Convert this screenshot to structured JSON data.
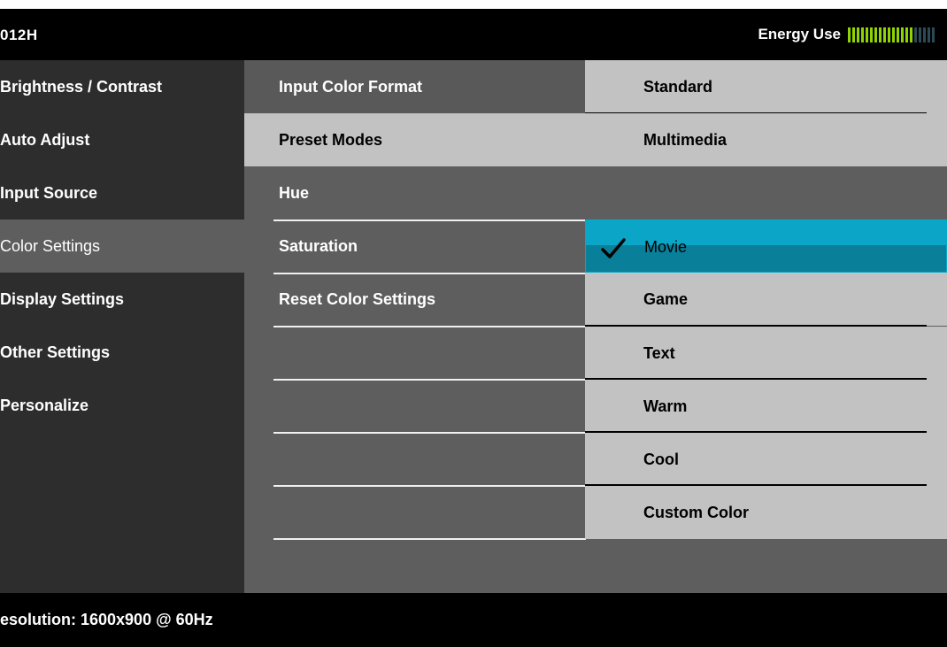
{
  "header": {
    "model": "012H",
    "energy_label": "Energy Use",
    "energy_level": 0.75
  },
  "left_menu": {
    "items": [
      {
        "label": "Brightness / Contrast",
        "selected": false
      },
      {
        "label": "Auto Adjust",
        "selected": false
      },
      {
        "label": "Input Source",
        "selected": false
      },
      {
        "label": "Color Settings",
        "selected": true
      },
      {
        "label": "Display Settings",
        "selected": false
      },
      {
        "label": "Other Settings",
        "selected": false
      },
      {
        "label": "Personalize",
        "selected": false
      }
    ]
  },
  "color_menu": {
    "items": [
      {
        "label": "Input Color Format"
      },
      {
        "label": "Preset Modes"
      },
      {
        "label": "Hue"
      },
      {
        "label": "Saturation"
      },
      {
        "label": "Reset Color Settings"
      }
    ]
  },
  "preset_modes": {
    "options": [
      {
        "label": "Standard",
        "selected": false
      },
      {
        "label": "Multimedia",
        "selected": false
      },
      {
        "label": "Movie",
        "selected": true
      },
      {
        "label": "Game",
        "selected": false
      },
      {
        "label": "Text",
        "selected": false
      },
      {
        "label": "Warm",
        "selected": false
      },
      {
        "label": "Cool",
        "selected": false
      },
      {
        "label": "Custom Color",
        "selected": false
      }
    ],
    "check_icon": "check-icon"
  },
  "footer": {
    "resolution": "esolution: 1600x900 @ 60Hz"
  },
  "colors": {
    "energy_on": "#8fd400",
    "energy_off": "#2c4a55",
    "highlight": "#0aa5c7"
  }
}
